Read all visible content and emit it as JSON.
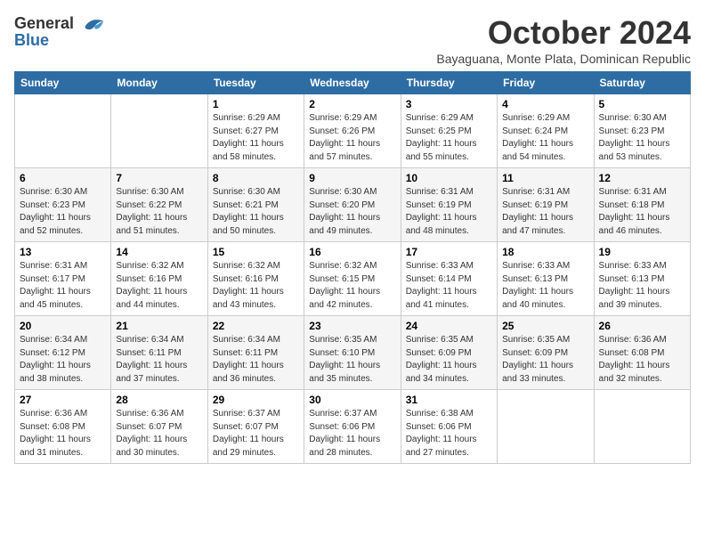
{
  "logo": {
    "general": "General",
    "blue": "Blue"
  },
  "title": "October 2024",
  "subtitle": "Bayaguana, Monte Plata, Dominican Republic",
  "days_of_week": [
    "Sunday",
    "Monday",
    "Tuesday",
    "Wednesday",
    "Thursday",
    "Friday",
    "Saturday"
  ],
  "weeks": [
    [
      {
        "day": "",
        "info": ""
      },
      {
        "day": "",
        "info": ""
      },
      {
        "day": "1",
        "sunrise": "6:29 AM",
        "sunset": "6:27 PM",
        "daylight": "11 hours and 58 minutes."
      },
      {
        "day": "2",
        "sunrise": "6:29 AM",
        "sunset": "6:26 PM",
        "daylight": "11 hours and 57 minutes."
      },
      {
        "day": "3",
        "sunrise": "6:29 AM",
        "sunset": "6:25 PM",
        "daylight": "11 hours and 55 minutes."
      },
      {
        "day": "4",
        "sunrise": "6:29 AM",
        "sunset": "6:24 PM",
        "daylight": "11 hours and 54 minutes."
      },
      {
        "day": "5",
        "sunrise": "6:30 AM",
        "sunset": "6:23 PM",
        "daylight": "11 hours and 53 minutes."
      }
    ],
    [
      {
        "day": "6",
        "sunrise": "6:30 AM",
        "sunset": "6:23 PM",
        "daylight": "11 hours and 52 minutes."
      },
      {
        "day": "7",
        "sunrise": "6:30 AM",
        "sunset": "6:22 PM",
        "daylight": "11 hours and 51 minutes."
      },
      {
        "day": "8",
        "sunrise": "6:30 AM",
        "sunset": "6:21 PM",
        "daylight": "11 hours and 50 minutes."
      },
      {
        "day": "9",
        "sunrise": "6:30 AM",
        "sunset": "6:20 PM",
        "daylight": "11 hours and 49 minutes."
      },
      {
        "day": "10",
        "sunrise": "6:31 AM",
        "sunset": "6:19 PM",
        "daylight": "11 hours and 48 minutes."
      },
      {
        "day": "11",
        "sunrise": "6:31 AM",
        "sunset": "6:19 PM",
        "daylight": "11 hours and 47 minutes."
      },
      {
        "day": "12",
        "sunrise": "6:31 AM",
        "sunset": "6:18 PM",
        "daylight": "11 hours and 46 minutes."
      }
    ],
    [
      {
        "day": "13",
        "sunrise": "6:31 AM",
        "sunset": "6:17 PM",
        "daylight": "11 hours and 45 minutes."
      },
      {
        "day": "14",
        "sunrise": "6:32 AM",
        "sunset": "6:16 PM",
        "daylight": "11 hours and 44 minutes."
      },
      {
        "day": "15",
        "sunrise": "6:32 AM",
        "sunset": "6:16 PM",
        "daylight": "11 hours and 43 minutes."
      },
      {
        "day": "16",
        "sunrise": "6:32 AM",
        "sunset": "6:15 PM",
        "daylight": "11 hours and 42 minutes."
      },
      {
        "day": "17",
        "sunrise": "6:33 AM",
        "sunset": "6:14 PM",
        "daylight": "11 hours and 41 minutes."
      },
      {
        "day": "18",
        "sunrise": "6:33 AM",
        "sunset": "6:13 PM",
        "daylight": "11 hours and 40 minutes."
      },
      {
        "day": "19",
        "sunrise": "6:33 AM",
        "sunset": "6:13 PM",
        "daylight": "11 hours and 39 minutes."
      }
    ],
    [
      {
        "day": "20",
        "sunrise": "6:34 AM",
        "sunset": "6:12 PM",
        "daylight": "11 hours and 38 minutes."
      },
      {
        "day": "21",
        "sunrise": "6:34 AM",
        "sunset": "6:11 PM",
        "daylight": "11 hours and 37 minutes."
      },
      {
        "day": "22",
        "sunrise": "6:34 AM",
        "sunset": "6:11 PM",
        "daylight": "11 hours and 36 minutes."
      },
      {
        "day": "23",
        "sunrise": "6:35 AM",
        "sunset": "6:10 PM",
        "daylight": "11 hours and 35 minutes."
      },
      {
        "day": "24",
        "sunrise": "6:35 AM",
        "sunset": "6:09 PM",
        "daylight": "11 hours and 34 minutes."
      },
      {
        "day": "25",
        "sunrise": "6:35 AM",
        "sunset": "6:09 PM",
        "daylight": "11 hours and 33 minutes."
      },
      {
        "day": "26",
        "sunrise": "6:36 AM",
        "sunset": "6:08 PM",
        "daylight": "11 hours and 32 minutes."
      }
    ],
    [
      {
        "day": "27",
        "sunrise": "6:36 AM",
        "sunset": "6:08 PM",
        "daylight": "11 hours and 31 minutes."
      },
      {
        "day": "28",
        "sunrise": "6:36 AM",
        "sunset": "6:07 PM",
        "daylight": "11 hours and 30 minutes."
      },
      {
        "day": "29",
        "sunrise": "6:37 AM",
        "sunset": "6:07 PM",
        "daylight": "11 hours and 29 minutes."
      },
      {
        "day": "30",
        "sunrise": "6:37 AM",
        "sunset": "6:06 PM",
        "daylight": "11 hours and 28 minutes."
      },
      {
        "day": "31",
        "sunrise": "6:38 AM",
        "sunset": "6:06 PM",
        "daylight": "11 hours and 27 minutes."
      },
      {
        "day": "",
        "info": ""
      },
      {
        "day": "",
        "info": ""
      }
    ]
  ],
  "labels": {
    "sunrise_prefix": "Sunrise: ",
    "sunset_prefix": "Sunset: ",
    "daylight_prefix": "Daylight: "
  }
}
